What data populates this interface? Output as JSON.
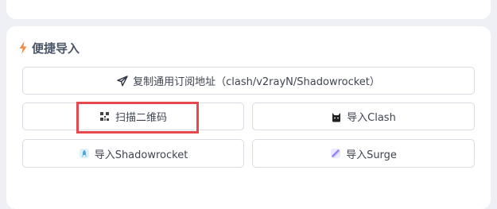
{
  "section": {
    "title": "便捷导入",
    "title_icon": "bolt-icon",
    "accent_color": "#f08c4a"
  },
  "buttons": {
    "copy": {
      "label": "复制通用订阅地址（clash/v2rayN/Shadowrocket）",
      "icon": "send-icon"
    },
    "scan": {
      "label": "扫描二维码",
      "icon": "qrcode-icon"
    },
    "clash": {
      "label": "导入Clash",
      "icon": "cat-icon"
    },
    "shadowrocket": {
      "label": "导入Shadowrocket",
      "icon": "rocket-icon"
    },
    "surge": {
      "label": "导入Surge",
      "icon": "surge-icon"
    }
  },
  "highlight": {
    "target": "scan",
    "color": "#e5484d"
  }
}
